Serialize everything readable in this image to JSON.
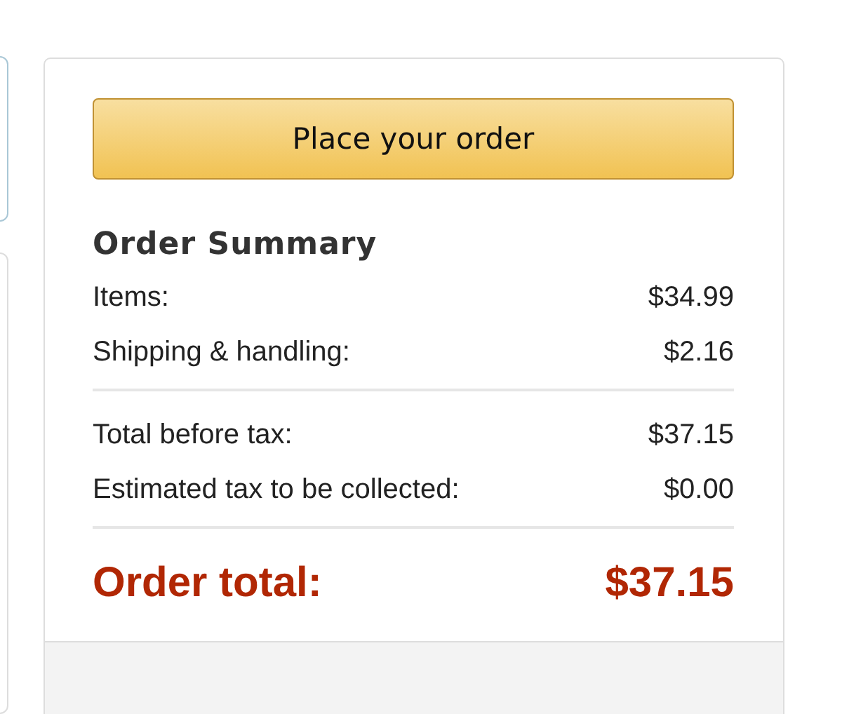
{
  "place_order_button": "Place your order",
  "summary": {
    "heading": "Order Summary",
    "groups": [
      {
        "rows": [
          {
            "label": "Items:",
            "amount": "$34.99"
          },
          {
            "label": "Shipping & handling:",
            "amount": "$2.16"
          }
        ]
      },
      {
        "rows": [
          {
            "label": "Total before tax:",
            "amount": "$37.15"
          },
          {
            "label": "Estimated tax to be collected:",
            "amount": "$0.00"
          }
        ]
      }
    ],
    "total": {
      "label": "Order total:",
      "amount": "$37.15"
    }
  }
}
